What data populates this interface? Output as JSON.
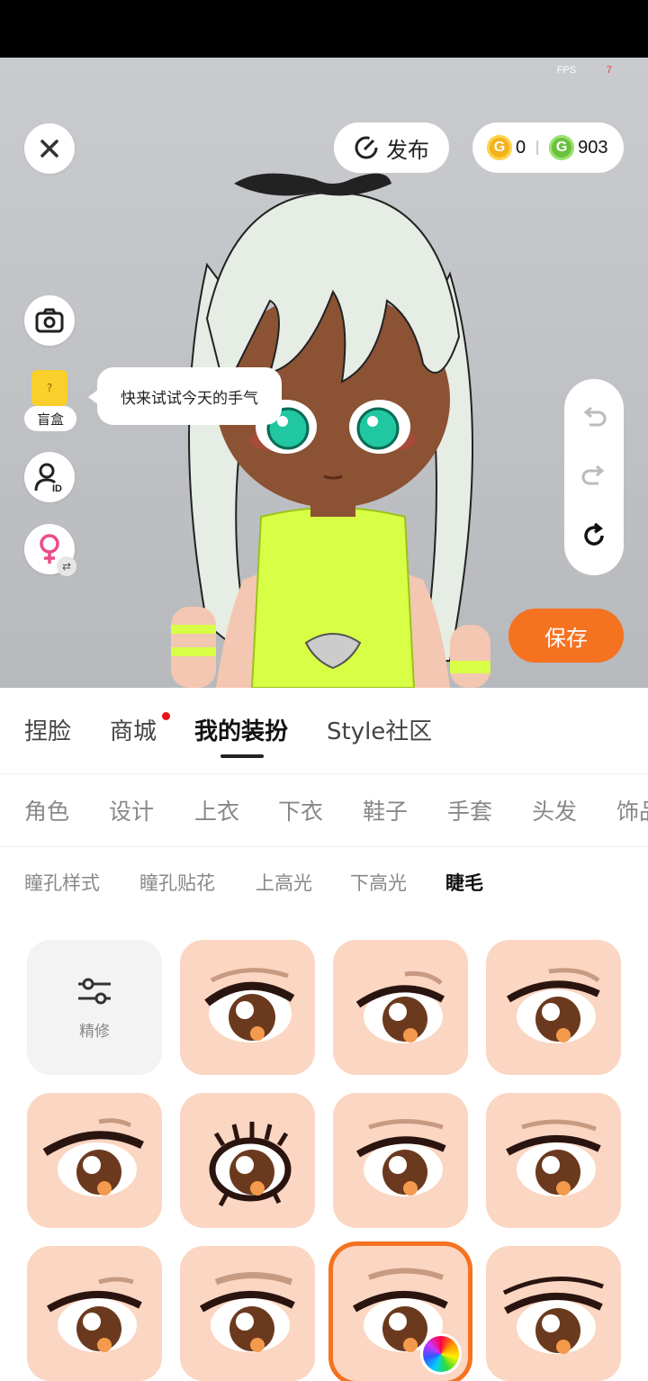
{
  "fps": {
    "label": "FPS",
    "value": "7"
  },
  "toolbar": {
    "publish_label": "发布",
    "gold_count": "0",
    "green_count": "903",
    "save_label": "保存"
  },
  "side": {
    "blind_box_label": "盲盒",
    "tip_bubble": "快来试试今天的手气"
  },
  "main_tabs": [
    {
      "label": "捏脸"
    },
    {
      "label": "商城"
    },
    {
      "label": "我的装扮"
    },
    {
      "label": "Style社区"
    }
  ],
  "category_tabs": [
    {
      "label": "角色"
    },
    {
      "label": "设计"
    },
    {
      "label": "上衣"
    },
    {
      "label": "下衣"
    },
    {
      "label": "鞋子"
    },
    {
      "label": "手套"
    },
    {
      "label": "头发"
    },
    {
      "label": "饰品"
    }
  ],
  "sub_tabs": [
    {
      "label": "瞳孔样式"
    },
    {
      "label": "瞳孔贴花"
    },
    {
      "label": "上高光"
    },
    {
      "label": "下高光"
    },
    {
      "label": "睫毛"
    }
  ],
  "grid": {
    "edit_label": "精修"
  },
  "colors": {
    "accent": "#f57220",
    "skin": "#fbd6c2",
    "hair": "#e8efe6",
    "outfit": "#d8ff45",
    "eye": "#20c7a0"
  }
}
